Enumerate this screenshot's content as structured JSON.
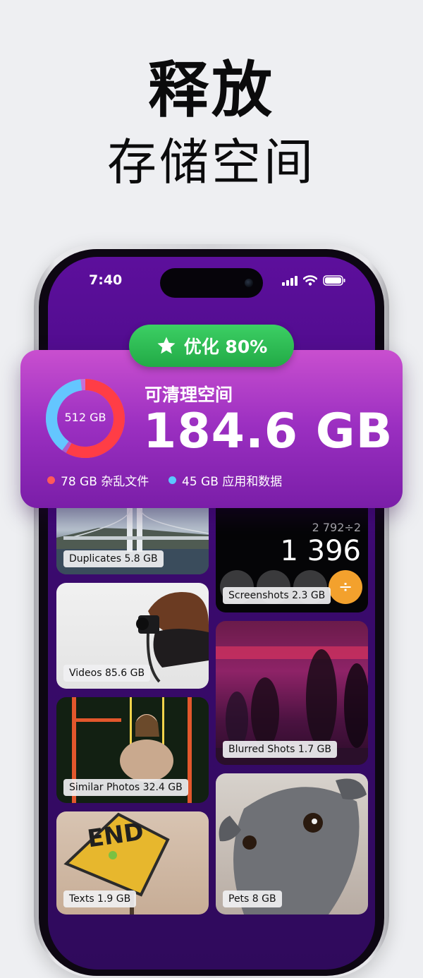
{
  "headline": {
    "line1": "释放",
    "line2": "存储空间"
  },
  "status_bar": {
    "time": "7:40"
  },
  "badge": {
    "label": "优化 80%"
  },
  "summary": {
    "subtitle": "可清理空间",
    "amount": "184.6 GB",
    "total_label": "512 GB",
    "donut": {
      "red_fraction": 0.6,
      "blue_fraction": 0.4
    },
    "legend": [
      {
        "label": "78 GB 杂乱文件",
        "color": "#ff5a5a"
      },
      {
        "label": "45 GB 应用和数据",
        "color": "#5bc8ff"
      }
    ]
  },
  "calculator": {
    "expression": "2 792÷2",
    "result": "1 396"
  },
  "tiles": {
    "duplicates": "Duplicates 5.8 GB",
    "screenshots": "Screenshots 2.3 GB",
    "videos": "Videos 85.6 GB",
    "blurred": "Blurred Shots 1.7 GB",
    "similar": "Similar Photos 32.4 GB",
    "texts": "Texts 1.9 GB",
    "pets": "Pets 8 GB"
  },
  "sign_text": "END",
  "colors": {
    "accent_green": "#2bb94f",
    "card_purple": "#a834c6",
    "screen_purple": "#4b0b88"
  }
}
